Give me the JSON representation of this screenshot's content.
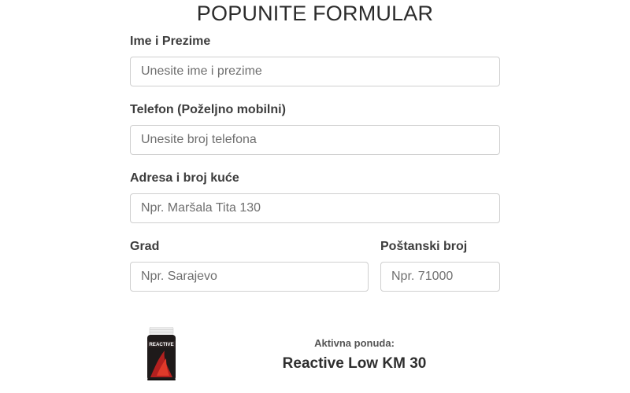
{
  "form": {
    "title": "POPUNITE FORMULAR",
    "fields": {
      "name": {
        "label": "Ime i Prezime",
        "placeholder": "Unesite ime i prezime"
      },
      "phone": {
        "label": "Telefon (Poželjno mobilni)",
        "placeholder": "Unesite broj telefona"
      },
      "address": {
        "label": "Adresa i broj kuće",
        "placeholder": "Npr. Maršala Tita 130"
      },
      "city": {
        "label": "Grad",
        "placeholder": "Npr. Sarajevo"
      },
      "postal": {
        "label": "Poštanski broj",
        "placeholder": "Npr. 71000"
      }
    }
  },
  "offer": {
    "caption": "Aktivna ponuda:",
    "name": "Reactive Low KM 30",
    "product_label": "REACTIVE",
    "colors": {
      "jar_body": "#1e1a1a",
      "jar_lid": "#e9e9e9",
      "label_red": "#b3201f"
    }
  }
}
